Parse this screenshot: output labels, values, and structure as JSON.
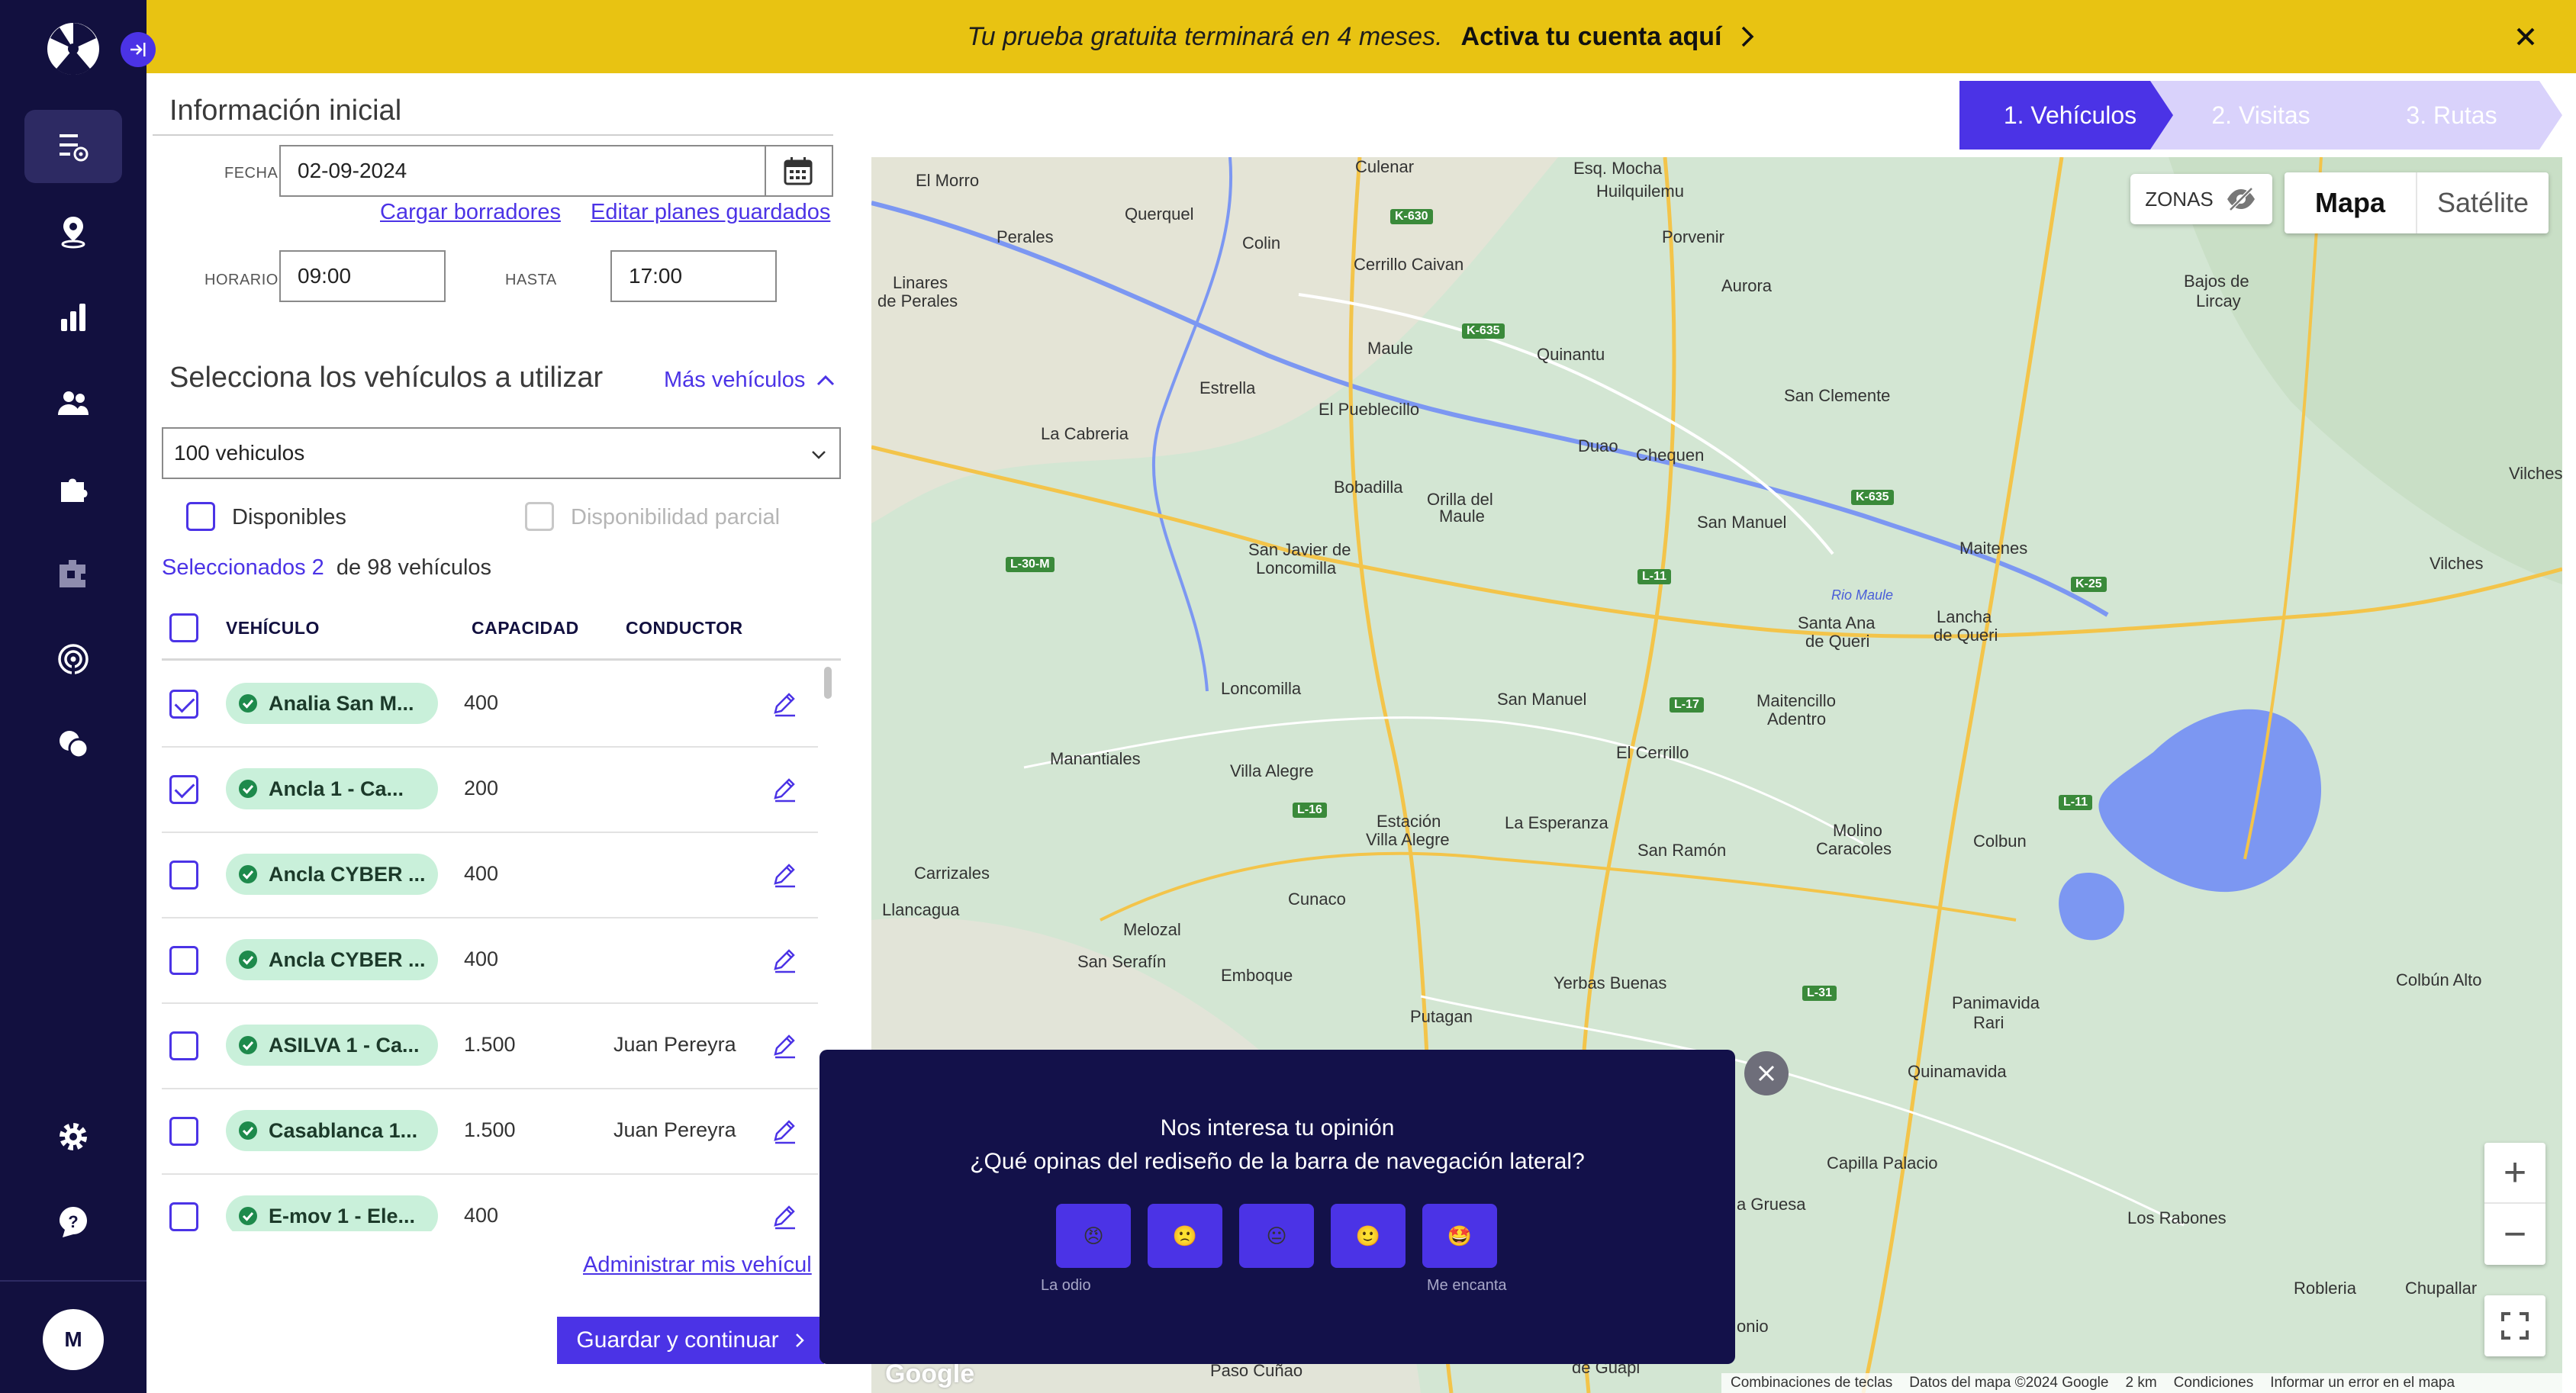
{
  "banner": {
    "message": "Tu prueba gratuita terminará en 4 meses.",
    "link": "Activa tu cuenta aquí"
  },
  "sidebar": {
    "items": [
      "routes-icon",
      "location-pin-icon",
      "bar-chart-icon",
      "users-icon",
      "puzzle-icon",
      "integrations-icon",
      "radar-icon",
      "chat-icon",
      "settings-icon",
      "help-icon"
    ],
    "avatar": "M"
  },
  "info": {
    "title": "Información inicial",
    "date_label": "FECHA",
    "date_value": "02-09-2024",
    "load_drafts": "Cargar borradores",
    "edit_plans": "Editar planes guardados",
    "schedule_label": "HORARIO",
    "schedule_from": "09:00",
    "until_label": "HASTA",
    "schedule_to": "17:00"
  },
  "vehicles": {
    "title": "Selecciona los vehículos a utilizar",
    "more": "Más vehículos",
    "select_value": "100 vehiculos",
    "filter_available": "Disponibles",
    "filter_partial": "Disponibilidad parcial",
    "selected_link": "Seleccionados 2",
    "selected_rest": "de 98 vehículos",
    "columns": [
      "VEHÍCULO",
      "CAPACIDAD",
      "CONDUCTOR"
    ],
    "rows": [
      {
        "name": "Analia San M...",
        "capacity": "400",
        "driver": "",
        "checked": true
      },
      {
        "name": "Ancla 1 - Ca...",
        "capacity": "200",
        "driver": "",
        "checked": true
      },
      {
        "name": "Ancla CYBER ...",
        "capacity": "400",
        "driver": "",
        "checked": false
      },
      {
        "name": "Ancla CYBER ...",
        "capacity": "400",
        "driver": "",
        "checked": false
      },
      {
        "name": "ASILVA 1 - Ca...",
        "capacity": "1.500",
        "driver": "Juan Pereyra",
        "checked": false
      },
      {
        "name": "Casablanca 1...",
        "capacity": "1.500",
        "driver": "Juan Pereyra",
        "checked": false
      },
      {
        "name": "E-mov 1 - Ele...",
        "capacity": "400",
        "driver": "",
        "checked": false
      }
    ],
    "manage_link": "Administrar mis vehícul",
    "save_button": "Guardar y continuar"
  },
  "stepper": {
    "steps": [
      "1. Vehículos",
      "2. Visitas",
      "3. Rutas"
    ],
    "active_color": "#4b33e6",
    "inactive_color": "#d9d2fb"
  },
  "map": {
    "zonas": "ZONAS",
    "map_type": "Mapa",
    "satellite_type": "Satélite",
    "zoom_in": "+",
    "zoom_out": "−",
    "google": "Google",
    "attribution": [
      "Combinaciones de teclas",
      "Datos del mapa ©2024 Google",
      "2 km",
      "Condiciones",
      "Informar un error en el mapa"
    ],
    "places": [
      {
        "name": "El Morro"
      },
      {
        "name": "Culenar"
      },
      {
        "name": "Esq. Mocha"
      },
      {
        "name": "Huilquilemu"
      },
      {
        "name": "Perales"
      },
      {
        "name": "Querquel"
      },
      {
        "name": "Colin"
      },
      {
        "name": "Porvenir"
      },
      {
        "name": "Cerrillo Caivan"
      },
      {
        "name": "Linares"
      },
      {
        "name": "de Perales"
      },
      {
        "name": "Aurora"
      },
      {
        "name": "Bajos de"
      },
      {
        "name": "Lircay"
      },
      {
        "name": "Maule"
      },
      {
        "name": "Quinantu"
      },
      {
        "name": "Estrella"
      },
      {
        "name": "El Pueblecillo"
      },
      {
        "name": "San Clemente"
      },
      {
        "name": "La Cabreria"
      },
      {
        "name": "Duao"
      },
      {
        "name": "Chequen"
      },
      {
        "name": "Vilches"
      },
      {
        "name": "Bobadilla"
      },
      {
        "name": "Orilla del"
      },
      {
        "name": "Maule"
      },
      {
        "name": "San Manuel"
      },
      {
        "name": "San Javier de"
      },
      {
        "name": "Loncomilla"
      },
      {
        "name": "Maitenes"
      },
      {
        "name": "Vilches"
      },
      {
        "name": "Rio Maule"
      },
      {
        "name": "Santa Ana"
      },
      {
        "name": "de Queri"
      },
      {
        "name": "Lancha"
      },
      {
        "name": "de Queri"
      },
      {
        "name": "Loncomilla"
      },
      {
        "name": "San Manuel"
      },
      {
        "name": "Maitencillo"
      },
      {
        "name": "Adentro"
      },
      {
        "name": "Manantiales"
      },
      {
        "name": "Villa Alegre"
      },
      {
        "name": "El Cerrillo"
      },
      {
        "name": "Estación"
      },
      {
        "name": "Villa Alegre"
      },
      {
        "name": "La Esperanza"
      },
      {
        "name": "Molino"
      },
      {
        "name": "Caracoles"
      },
      {
        "name": "Colbun"
      },
      {
        "name": "San Ramón"
      },
      {
        "name": "Carrizales"
      },
      {
        "name": "Llancagua"
      },
      {
        "name": "Cunaco"
      },
      {
        "name": "Melozal"
      },
      {
        "name": "San Serafín"
      },
      {
        "name": "Emboque"
      },
      {
        "name": "Yerbas Buenas"
      },
      {
        "name": "Colbún Alto"
      },
      {
        "name": "Panimavida"
      },
      {
        "name": "Rari"
      },
      {
        "name": "Putagan"
      },
      {
        "name": "Quinamavida"
      },
      {
        "name": "Capilla Palacio"
      },
      {
        "name": "a Gruesa"
      },
      {
        "name": "Los Rabones"
      },
      {
        "name": "Robleria"
      },
      {
        "name": "Chupallar"
      },
      {
        "name": "onio"
      },
      {
        "name": "Paso Cuñao"
      },
      {
        "name": "de Guapi"
      }
    ],
    "road_tags": [
      {
        "name": "K-630"
      },
      {
        "name": "K-635"
      },
      {
        "name": "K-635"
      },
      {
        "name": "L-30-M"
      },
      {
        "name": "L-11"
      },
      {
        "name": "K-25"
      },
      {
        "name": "L-17"
      },
      {
        "name": "L-16"
      },
      {
        "name": "L-11"
      },
      {
        "name": "L-31"
      }
    ]
  },
  "feedback": {
    "title": "Nos interesa tu opinión",
    "question": "¿Qué opinas del rediseño de la barra de navegación lateral?",
    "options": [
      "😠",
      "🙁",
      "😐",
      "🙂",
      "🤩"
    ],
    "label_low": "La odio",
    "label_high": "Me encanta"
  }
}
